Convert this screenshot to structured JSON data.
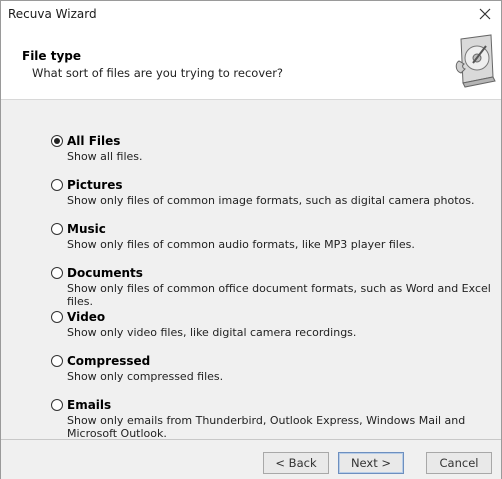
{
  "window": {
    "title": "Recuva Wizard"
  },
  "header": {
    "title": "File type",
    "subtitle": "What sort of files are you trying to recover?"
  },
  "icons": {
    "close": "close-icon",
    "drive": "hard-drive-icon"
  },
  "options": [
    {
      "label": "All Files",
      "description": "Show all files.",
      "selected": true
    },
    {
      "label": "Pictures",
      "description": "Show only files of common image formats, such as digital camera photos.",
      "selected": false
    },
    {
      "label": "Music",
      "description": "Show only files of common audio formats, like MP3 player files.",
      "selected": false
    },
    {
      "label": "Documents",
      "description": "Show only files of common office document formats, such as Word and Excel files.",
      "selected": false
    },
    {
      "label": "Video",
      "description": "Show only video files, like digital camera recordings.",
      "selected": false
    },
    {
      "label": "Compressed",
      "description": "Show only compressed files.",
      "selected": false
    },
    {
      "label": "Emails",
      "description": "Show only emails from Thunderbird, Outlook Express, Windows Mail and Microsoft Outlook.",
      "selected": false
    }
  ],
  "buttons": {
    "back": "< Back",
    "next": "Next >",
    "cancel": "Cancel"
  }
}
